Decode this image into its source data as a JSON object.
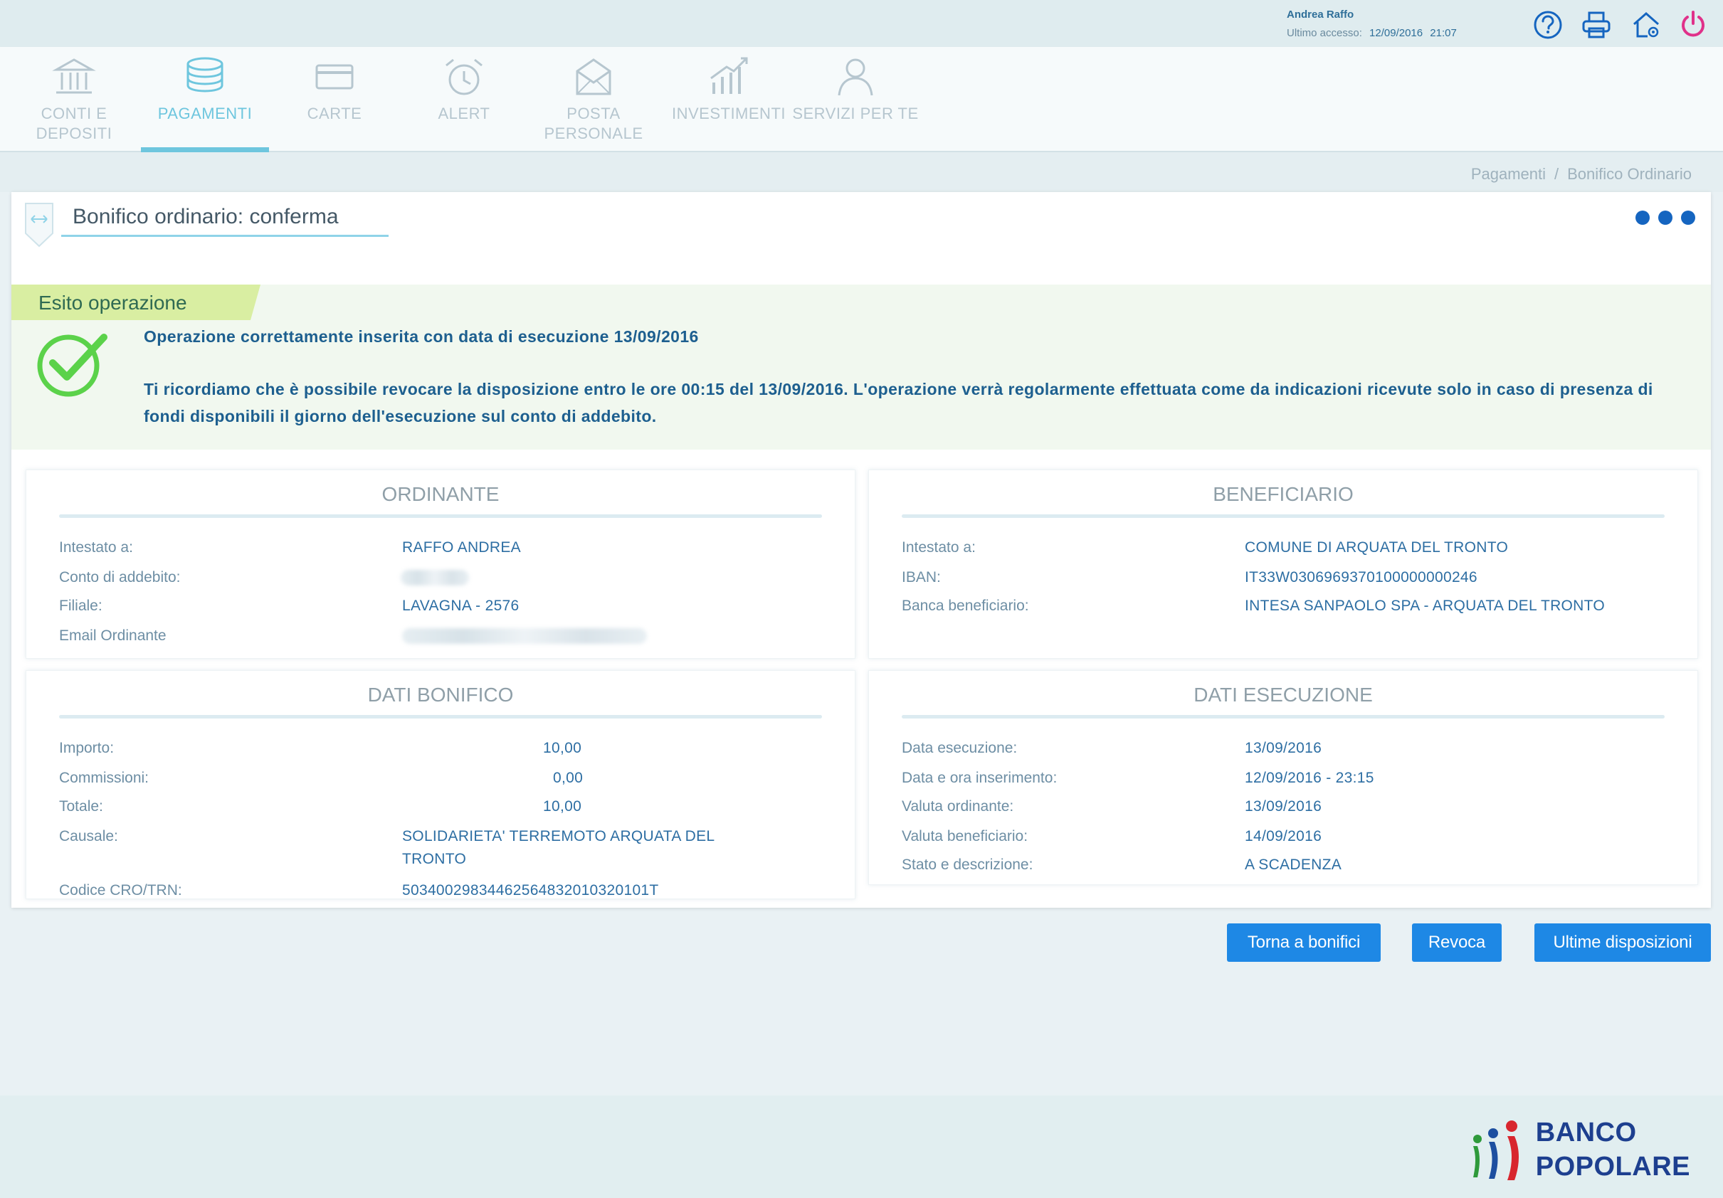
{
  "header": {
    "user_name": "Andrea Raffo",
    "last_access_label": "Ultimo accesso:",
    "last_access_date": "12/09/2016",
    "last_access_time": "21:07"
  },
  "icons": {
    "help": "help-icon",
    "print": "printer-icon",
    "home": "home-icon",
    "logout": "power-icon"
  },
  "nav": {
    "items": [
      {
        "label": "CONTI E DEPOSITI",
        "icon": "bank-icon"
      },
      {
        "label": "PAGAMENTI",
        "icon": "coins-icon",
        "active": true
      },
      {
        "label": "CARTE",
        "icon": "card-icon"
      },
      {
        "label": "ALERT",
        "icon": "alarm-clock-icon"
      },
      {
        "label": "POSTA PERSONALE",
        "icon": "envelope-icon"
      },
      {
        "label": "INVESTIMENTI",
        "icon": "chart-icon"
      },
      {
        "label": "SERVIZI PER TE",
        "icon": "person-icon"
      }
    ]
  },
  "breadcrumb": {
    "items": [
      "Pagamenti",
      "Bonifico Ordinario"
    ],
    "separator": "/"
  },
  "panel": {
    "title": "Bonifico ordinario: conferma"
  },
  "esito": {
    "label": "Esito operazione",
    "message1": "Operazione correttamente inserita con data di esecuzione 13/09/2016",
    "message2": "Ti ricordiamo che è possibile revocare la disposizione entro le ore 00:15 del 13/09/2016. L'operazione verrà regolarmente effettuata come da indicazioni ricevute solo in caso di presenza di fondi disponibili il giorno dell'esecuzione sul conto di addebito."
  },
  "ordinante": {
    "title": "ORDINANTE",
    "rows": [
      {
        "label": "Intestato a:",
        "value": "RAFFO ANDREA"
      },
      {
        "label": "Conto di addebito:",
        "value": ""
      },
      {
        "label": "Filiale:",
        "value": "LAVAGNA - 2576"
      },
      {
        "label": "Email Ordinante",
        "value": ""
      }
    ]
  },
  "beneficiario": {
    "title": "BENEFICIARIO",
    "rows": [
      {
        "label": "Intestato a:",
        "value": "COMUNE DI ARQUATA DEL TRONTO"
      },
      {
        "label": "IBAN:",
        "value": "IT33W0306969370100000000246"
      },
      {
        "label": "Banca beneficiario:",
        "value": "INTESA SANPAOLO SPA - ARQUATA DEL TRONTO"
      }
    ]
  },
  "dati_bonifico": {
    "title": "DATI BONIFICO",
    "rows": [
      {
        "label": "Importo:",
        "value": "10,00"
      },
      {
        "label": "Commissioni:",
        "value": "0,00"
      },
      {
        "label": "Totale:",
        "value": "10,00"
      },
      {
        "label": "Causale:",
        "value_line1": "SOLIDARIETA' TERREMOTO ARQUATA DEL",
        "value_line2": "TRONTO"
      },
      {
        "label": "Codice CRO/TRN:",
        "value": "50340029834462564832010320101T"
      }
    ]
  },
  "dati_esecuzione": {
    "title": "DATI ESECUZIONE",
    "rows": [
      {
        "label": "Data esecuzione:",
        "value": "13/09/2016"
      },
      {
        "label": "Data e ora inserimento:",
        "value": "12/09/2016 - 23:15"
      },
      {
        "label": "Valuta ordinante:",
        "value": "13/09/2016"
      },
      {
        "label": "Valuta beneficiario:",
        "value": "14/09/2016"
      },
      {
        "label": "Stato e descrizione:",
        "value": "A SCADENZA"
      }
    ]
  },
  "buttons": {
    "back": "Torna a bonifici",
    "revoke": "Revoca",
    "latest": "Ultime disposizioni"
  },
  "footer": {
    "logo_line1": "BANCO",
    "logo_line2": "POPOLARE"
  },
  "colors": {
    "accent": "#6ec6de",
    "button": "#1e88e5",
    "text_value": "#2d6ea3",
    "success": "#5bd24a",
    "logout": "#e0318a"
  }
}
